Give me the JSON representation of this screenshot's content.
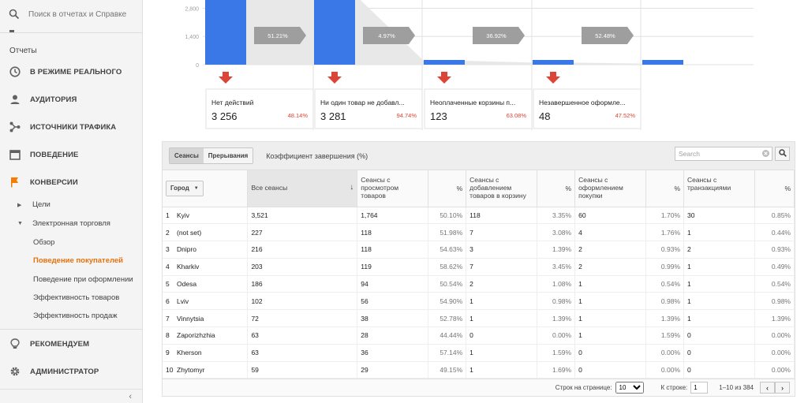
{
  "sidebar": {
    "search_placeholder": "Поиск в отчетах и Справке",
    "section_label": "Отчеты",
    "nav": [
      {
        "label": "В режиме реального",
        "icon": "clock-icon"
      },
      {
        "label": "Аудитория",
        "icon": "person-icon"
      },
      {
        "label": "Источники трафика",
        "icon": "acquisition-icon"
      },
      {
        "label": "Поведение",
        "icon": "behavior-icon"
      },
      {
        "label": "Конверсии",
        "icon": "flag-icon"
      }
    ],
    "sub": {
      "goals": "Цели",
      "ecommerce": "Электронная торговля"
    },
    "leaves": [
      "Обзор",
      "Поведение покупателей",
      "Поведение при оформлении",
      "Эффективность товаров",
      "Эффективность продаж"
    ],
    "bottom_nav": [
      {
        "label": "Рекомендуем",
        "icon": "lightbulb-icon"
      },
      {
        "label": "Администратор",
        "icon": "gear-icon"
      }
    ],
    "colors": {
      "accent": "#e8710a",
      "conversion_flag": "#f57c00"
    }
  },
  "funnel": {
    "y_ticks": [
      "2,800",
      "1,400",
      "0"
    ],
    "bar_color": "#3b78e7",
    "drop_color": "#db4437",
    "steps": [
      {
        "bar_value": 3521,
        "conversion": "51.21%",
        "drop_label": "Нет действий",
        "drop_value": "3 256",
        "drop_pct": "48.14%"
      },
      {
        "bar_value": 3463,
        "conversion": "4.97%",
        "drop_label": "Ни один товар не добавл...",
        "drop_value": "3 281",
        "drop_pct": "94.74%"
      },
      {
        "bar_value": 195,
        "conversion": "36.92%",
        "drop_label": "Неоплаченные корзины п...",
        "drop_value": "123",
        "drop_pct": "63.08%"
      },
      {
        "bar_value": 101,
        "conversion": "52.48%",
        "drop_label": "Незавершенное оформле...",
        "drop_value": "48",
        "drop_pct": "47.52%"
      },
      {
        "bar_value": 53
      }
    ]
  },
  "table": {
    "tabs": [
      "Сеансы",
      "Прерывания"
    ],
    "metric_label": "Коэффициент завершения (%)",
    "search_placeholder": "Search",
    "dimension": "Город",
    "headers": [
      "Все сеансы",
      "Сеансы с просмотром товаров",
      "%",
      "Сеансы с добавлением товаров в корзину",
      "%",
      "Сеансы с оформлением покупки",
      "%",
      "Сеансы с транзакциями",
      "%"
    ],
    "rows": [
      [
        "1",
        "Kyiv",
        "3,521",
        "1,764",
        "50.10%",
        "118",
        "3.35%",
        "60",
        "1.70%",
        "30",
        "0.85%"
      ],
      [
        "2",
        "(not set)",
        "227",
        "118",
        "51.98%",
        "7",
        "3.08%",
        "4",
        "1.76%",
        "1",
        "0.44%"
      ],
      [
        "3",
        "Dnipro",
        "216",
        "118",
        "54.63%",
        "3",
        "1.39%",
        "2",
        "0.93%",
        "2",
        "0.93%"
      ],
      [
        "4",
        "Kharkiv",
        "203",
        "119",
        "58.62%",
        "7",
        "3.45%",
        "2",
        "0.99%",
        "1",
        "0.49%"
      ],
      [
        "5",
        "Odesa",
        "186",
        "94",
        "50.54%",
        "2",
        "1.08%",
        "1",
        "0.54%",
        "1",
        "0.54%"
      ],
      [
        "6",
        "Lviv",
        "102",
        "56",
        "54.90%",
        "1",
        "0.98%",
        "1",
        "0.98%",
        "1",
        "0.98%"
      ],
      [
        "7",
        "Vinnytsia",
        "72",
        "38",
        "52.78%",
        "1",
        "1.39%",
        "1",
        "1.39%",
        "1",
        "1.39%"
      ],
      [
        "8",
        "Zaporizhzhia",
        "63",
        "28",
        "44.44%",
        "0",
        "0.00%",
        "1",
        "1.59%",
        "0",
        "0.00%"
      ],
      [
        "9",
        "Kherson",
        "63",
        "36",
        "57.14%",
        "1",
        "1.59%",
        "0",
        "0.00%",
        "0",
        "0.00%"
      ],
      [
        "10",
        "Zhytomyr",
        "59",
        "29",
        "49.15%",
        "1",
        "1.69%",
        "0",
        "0.00%",
        "0",
        "0.00%"
      ]
    ],
    "footer": {
      "rows_per_page_label": "Строк на странице:",
      "rows_per_page_value": "10",
      "goto_label": "К строке:",
      "goto_value": "1",
      "range": "1–10 из 384"
    }
  }
}
